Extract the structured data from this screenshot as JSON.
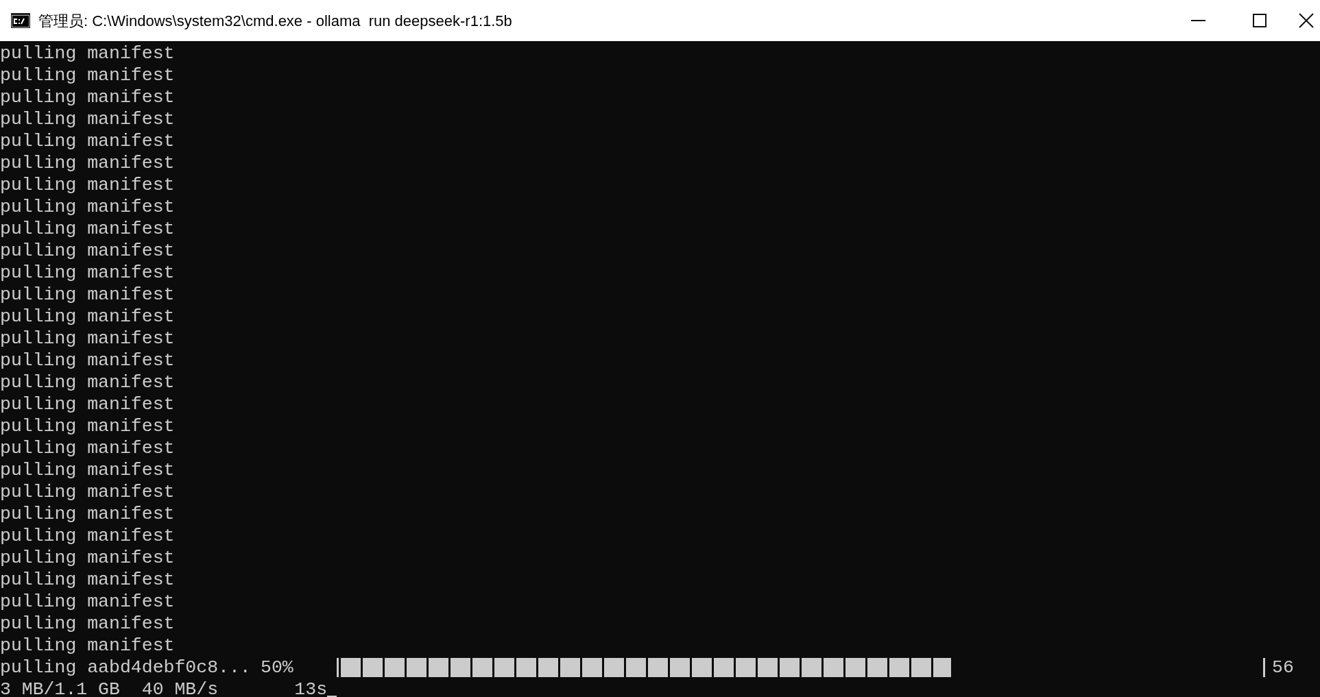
{
  "window": {
    "title": "管理员: C:\\Windows\\system32\\cmd.exe - ollama  run deepseek-r1:1.5b"
  },
  "console": {
    "lines": [
      "pulling manifest",
      "pulling manifest",
      "pulling manifest",
      "pulling manifest",
      "pulling manifest",
      "pulling manifest",
      "pulling manifest",
      "pulling manifest",
      "pulling manifest",
      "pulling manifest",
      "pulling manifest",
      "pulling manifest",
      "pulling manifest",
      "pulling manifest",
      "pulling manifest",
      "pulling manifest",
      "pulling manifest",
      "pulling manifest",
      "pulling manifest",
      "pulling manifest",
      "pulling manifest",
      "pulling manifest",
      "pulling manifest",
      "pulling manifest",
      "pulling manifest",
      "pulling manifest",
      "pulling manifest",
      "pulling manifest"
    ],
    "progress": {
      "label": "pulling aabd4debf0c8...",
      "percent": "50%",
      "level": 0.66,
      "tail": "56"
    },
    "stats": "3 MB/1.1 GB  40 MB/s       13s"
  }
}
